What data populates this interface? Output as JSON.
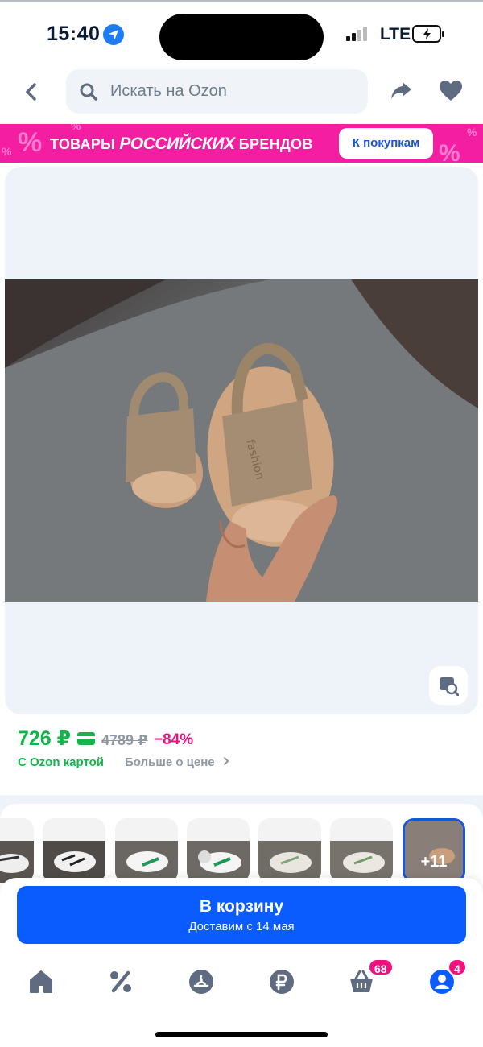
{
  "status_bar": {
    "time": "15:40",
    "network": "LTE"
  },
  "search": {
    "placeholder": "Искать на Ozon"
  },
  "banner": {
    "word1": "ТОВАРЫ",
    "word2": "РОССИЙСКИХ",
    "word3": "БРЕНДОВ",
    "button": "К покупкам",
    "bg_color": "#f41ea3"
  },
  "price": {
    "current": "726 ₽",
    "old": "4789 ₽",
    "discount": "−84%",
    "card_label": "С Ozon картой",
    "more_label": "Больше о цене",
    "color": "#11b54a"
  },
  "variants": {
    "more_count": "+11"
  },
  "cart": {
    "label": "В корзину",
    "delivery": "Доставим с 14 мая",
    "color": "#0a5cff"
  },
  "nav": {
    "items": [
      "home-icon",
      "percent-icon",
      "ozon-fresh-icon",
      "ruble-icon",
      "cart-icon",
      "profile-icon"
    ],
    "cart_badge": "68",
    "profile_badge": "4"
  }
}
